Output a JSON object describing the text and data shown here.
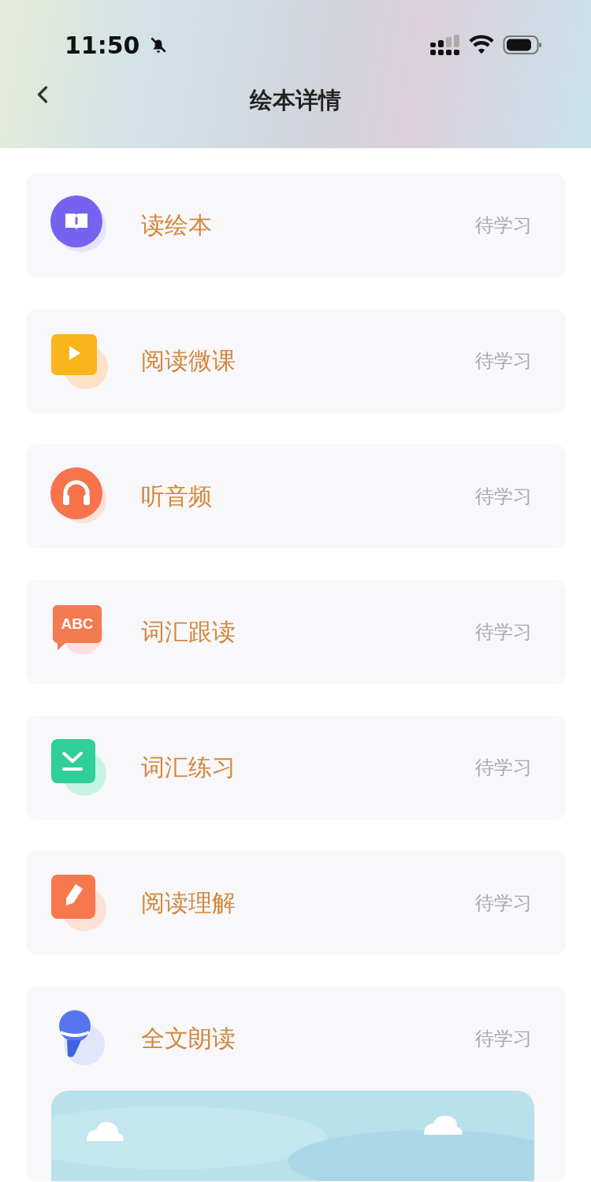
{
  "status_bar": {
    "time": "11:50"
  },
  "nav": {
    "title": "绘本详情"
  },
  "items": [
    {
      "kind": "book",
      "title": "读绘本",
      "status": "待学习"
    },
    {
      "kind": "video",
      "title": "阅读微课",
      "status": "待学习"
    },
    {
      "kind": "headphones",
      "title": "听音频",
      "status": "待学习"
    },
    {
      "kind": "abc",
      "icon_text": "ABC",
      "title": "词汇跟读",
      "status": "待学习"
    },
    {
      "kind": "check",
      "title": "词汇练习",
      "status": "待学习"
    },
    {
      "kind": "pencil",
      "title": "阅读理解",
      "status": "待学习"
    },
    {
      "kind": "mic",
      "title": "全文朗读",
      "status": "待学习"
    }
  ]
}
